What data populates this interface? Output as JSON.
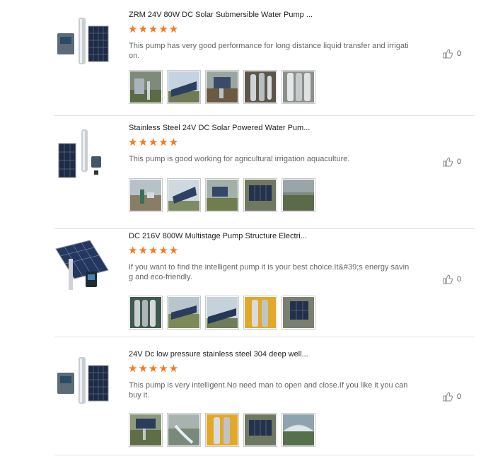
{
  "reviews": [
    {
      "title": "ZRM 24V 80W DC Solar Submersible Water Pump ...",
      "stars": "★★★★★",
      "rating": 5,
      "comment": "This pump has very good performance for long distance liquid transfer and irrigation.",
      "likes": "0",
      "thumb_icon": "solar-pump-product-icon",
      "photos": [
        "pump-installation-photo",
        "solar-panel-field-photo",
        "pump-site-photo",
        "pump-cylinders-photo",
        "steel-pump-closeup-photo"
      ]
    },
    {
      "title": "Stainless Steel 24V DC Solar Powered Water Pum...",
      "stars": "★★★★★",
      "rating": 5,
      "comment": "This pump is good working for agricultural irrigation aquaculture.",
      "likes": "0",
      "thumb_icon": "solar-pump-product-icon",
      "photos": [
        "irrigation-site-photo",
        "solar-panel-array-photo",
        "pump-field-photo",
        "solar-panel-rack-photo",
        "farm-landscape-photo"
      ]
    },
    {
      "title": "DC 216V 800W Multistage Pump Structure Electri...",
      "stars": "★★★★★",
      "rating": 5,
      "comment": "If you want to find the intelligent pump it is your best choice.It&#39;s energy saving and eco-friendly.",
      "likes": "0",
      "thumb_icon": "solar-pump-kit-icon",
      "photos": [
        "pump-stack-photo",
        "solar-field-photo",
        "solar-panel-photo",
        "yellow-pump-photo",
        "solar-panel-site-photo"
      ]
    },
    {
      "title": "24V Dc low pressure stainless steel 304 deep well...",
      "stars": "★★★★★",
      "rating": 5,
      "comment": "This pump is very intelligent.No need man to open and close.If you like it you can buy it.",
      "likes": "0",
      "thumb_icon": "solar-pump-product-icon",
      "photos": [
        "solar-installation-photo",
        "water-flow-photo",
        "yellow-pump-photo",
        "solar-panel-rack-photo",
        "greenhouse-photo"
      ]
    }
  ],
  "colors": {
    "star": "#f7791e",
    "divider": "#e2e2e2",
    "title": "#222222",
    "comment": "#666666"
  }
}
